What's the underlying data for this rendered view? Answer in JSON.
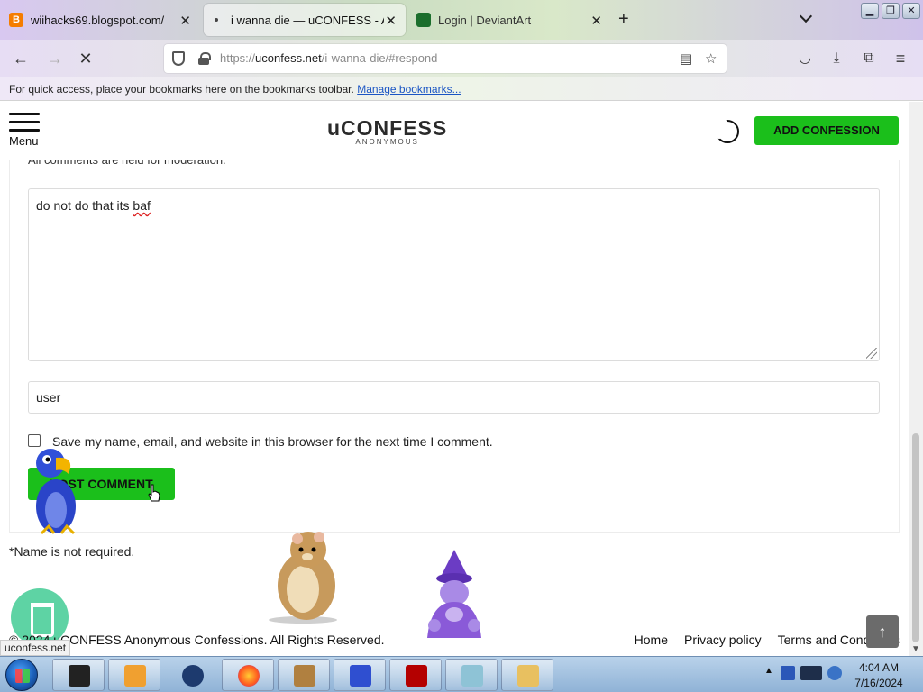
{
  "browser": {
    "tabs": [
      {
        "title": "wiihacks69.blogspot.com/",
        "favicon": "blogger-icon",
        "close": "✕"
      },
      {
        "title": "i wanna die — uCONFESS - Ano",
        "favicon": "loading-dot",
        "close": "✕"
      },
      {
        "title": "Login | DeviantArt",
        "favicon": "deviantart-icon"
      }
    ],
    "new_tab": "+",
    "url": {
      "scheme": "https://",
      "domain": "uconfess.net",
      "path": "/i-wanna-die/#respond"
    },
    "bookmarks_text": "For quick access, place your bookmarks here on the bookmarks toolbar.",
    "bookmarks_link": "Manage bookmarks...",
    "status_url": "uconfess.net"
  },
  "site": {
    "menu_label": "Menu",
    "logo_main": "uCONFESS",
    "logo_sub": "ANONYMOUS",
    "add_button": "ADD CONFESSION",
    "moderation_notice": "All comments are held for moderation.",
    "comment_text_before": "do not do that its ",
    "comment_text_misspelled": "baf",
    "name_value": "user",
    "save_label": "Save my name, email, and website in this browser for the next time I comment.",
    "post_button": "POST COMMENT",
    "name_note": "*Name is not required.",
    "footer_copy": "© 2024 uCONFESS Anonymous Confessions. All Rights Reserved.",
    "footer_links": [
      "Home",
      "Privacy policy",
      "Terms and Conditions"
    ],
    "totop_icon": "arrow-up-icon"
  },
  "taskbar": {
    "time": "4:04 AM",
    "date": "7/16/2024"
  },
  "colors": {
    "accent_green": "#1bbf1b",
    "link_blue": "#1a55c4",
    "cup_button": "#5ed3a4"
  }
}
